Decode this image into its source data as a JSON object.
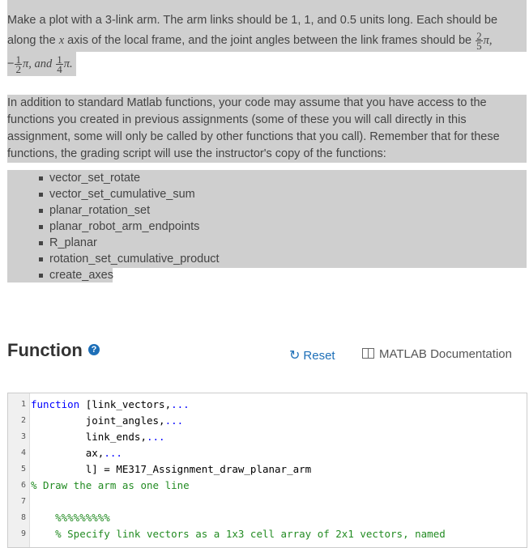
{
  "problem": {
    "line1": "Make a plot with a 3-link arm. The arm links should be 1, 1, and 0.5 units long. Each should be",
    "line2_a": "along the",
    "line2_var": "x",
    "line2_b": "axis of the local frame, and the joint angles between the link frames should be",
    "angle1": {
      "num": "2",
      "den": "5",
      "pi": "π,"
    },
    "angle2": {
      "sign": "−",
      "num": "1",
      "den": "2",
      "pi": "π, and"
    },
    "angle3": {
      "num": "1",
      "den": "4",
      "pi": "π."
    },
    "para2": "In addition to standard Matlab functions, your code may assume that you have access to the functions you created in previous assignments (some of these you will call directly in this assignment, some will only be called by other functions that you call). Remember that for these functions, the grading script will use the instructor's copy of the functions:",
    "functions": [
      "vector_set_rotate",
      "vector_set_cumulative_sum",
      "planar_rotation_set",
      "planar_robot_arm_endpoints",
      "R_planar",
      "rotation_set_cumulative_product",
      "create_axes"
    ]
  },
  "function_header": {
    "title": "Function",
    "help": "?",
    "reset_icon": "reset-icon",
    "reset_label": "Reset",
    "doc_icon": "book-icon",
    "doc_label": "MATLAB Documentation"
  },
  "editor": {
    "lines": [
      {
        "num": "1",
        "code": "function [link_vectors,..."
      },
      {
        "num": "2",
        "code": "         joint_angles,..."
      },
      {
        "num": "3",
        "code": "         link_ends,..."
      },
      {
        "num": "4",
        "code": "         ax,..."
      },
      {
        "num": "5",
        "code": "         l] = ME317_Assignment_draw_planar_arm"
      },
      {
        "num": "6",
        "code": "% Draw the arm as one line"
      },
      {
        "num": "7",
        "code": ""
      },
      {
        "num": "8",
        "code": "    %%%%%%%%%"
      },
      {
        "num": "9",
        "code": "    % Specify link vectors as a 1x3 cell array of 2x1 vectors, named"
      }
    ]
  }
}
